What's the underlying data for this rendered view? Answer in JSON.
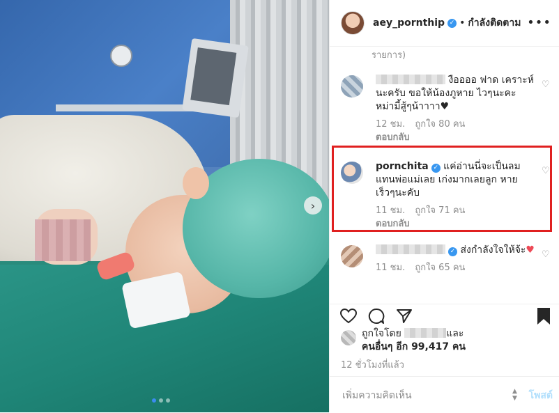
{
  "post": {
    "username": "aey_pornthip",
    "follow_status": "กำลังติดตาม",
    "bullet": "•",
    "more": "•••"
  },
  "comments": {
    "load_more": "รายการ)",
    "items": [
      {
        "user_blurred": true,
        "text_line": "งืออออ ฟาด เคราะห์นะครับ ขอให้น้องภูหาย ไวๆนะคะ หม่ามี้สู้ๆน้าาาา♥",
        "time": "12 ชม.",
        "likes": "ถูกใจ 80 คน",
        "reply": "ตอบกลับ"
      },
      {
        "username": "pornchita",
        "verified": "✓",
        "text_line": "แค่อ่านนี่จะเป็นลม แทนพ่อแม่เลย เก่งมากเลยลูก หายเร็วๆนะคับ",
        "time": "11 ชม.",
        "likes": "ถูกใจ 71 คน",
        "reply": "ตอบกลับ"
      },
      {
        "user_blurred": true,
        "verified": "✓",
        "text_line": "ส่งกำลังใจให้จ้ะ",
        "emoji": "♥",
        "time": "11 ชม.",
        "likes": "ถูกใจ 65 คน"
      }
    ]
  },
  "likes": {
    "prefix": "ถูกใจโดย",
    "conj": "และ",
    "others": "คนอื่นๆ อีก 99,417 คน"
  },
  "time_ago": "12 ชั่วโมงที่แล้ว",
  "add_comment": {
    "placeholder": "เพิ่มความคิดเห็น",
    "post_label": "โพสต์"
  },
  "colors": {
    "highlight": "#e02020",
    "verified": "#3897f0",
    "post_disabled": "#b2dffc"
  }
}
